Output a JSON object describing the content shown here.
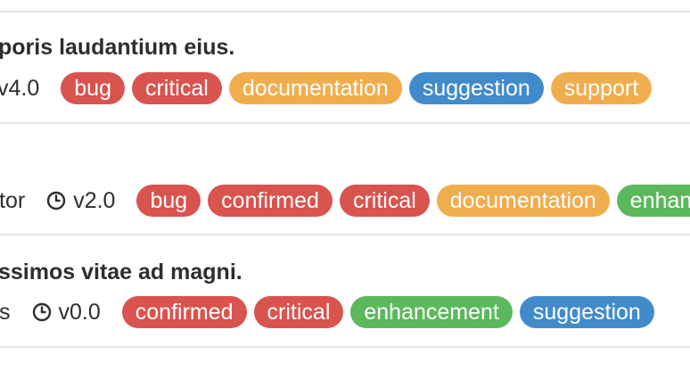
{
  "colors": {
    "bug": "#d9534f",
    "critical": "#d9534f",
    "confirmed": "#d9534f",
    "documentation": "#f0ad4e",
    "support": "#f0ad4e",
    "suggestion": "#428bca",
    "enhancement": "#5cb85c"
  },
  "issues": [
    {
      "title": "poris laudantium eius.",
      "meta_text": "",
      "milestone": "v4.0",
      "labels": [
        {
          "text": "bug",
          "color": "#d9534f"
        },
        {
          "text": "critical",
          "color": "#d9534f"
        },
        {
          "text": "documentation",
          "color": "#f0ad4e"
        },
        {
          "text": "suggestion",
          "color": "#428bca"
        },
        {
          "text": "support",
          "color": "#f0ad4e"
        }
      ]
    },
    {
      "title": "",
      "meta_text": "tor",
      "milestone": "v2.0",
      "labels": [
        {
          "text": "bug",
          "color": "#d9534f"
        },
        {
          "text": "confirmed",
          "color": "#d9534f"
        },
        {
          "text": "critical",
          "color": "#d9534f"
        },
        {
          "text": "documentation",
          "color": "#f0ad4e"
        },
        {
          "text": "enhancement",
          "color": "#5cb85c"
        }
      ]
    },
    {
      "title": "ssimos vitae ad magni.",
      "meta_text": "s",
      "milestone": "v0.0",
      "labels": [
        {
          "text": "confirmed",
          "color": "#d9534f"
        },
        {
          "text": "critical",
          "color": "#d9534f"
        },
        {
          "text": "enhancement",
          "color": "#5cb85c"
        },
        {
          "text": "suggestion",
          "color": "#428bca"
        }
      ]
    }
  ]
}
